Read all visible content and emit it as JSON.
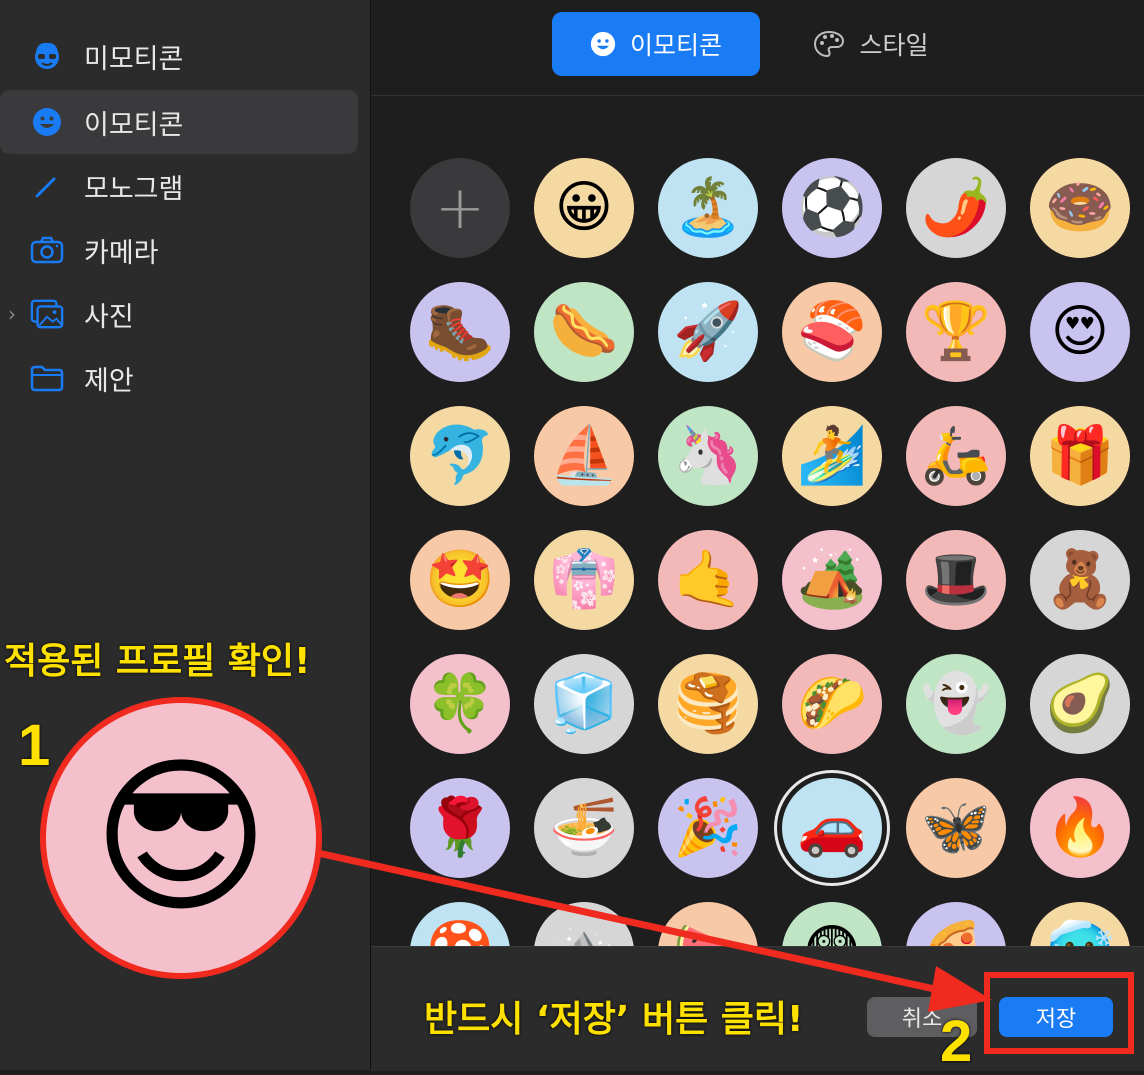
{
  "sidebar": {
    "items": [
      {
        "label": "미모티콘",
        "icon": "memoji-icon"
      },
      {
        "label": "이모티콘",
        "icon": "smiley-icon",
        "selected": true
      },
      {
        "label": "모노그램",
        "icon": "pencil-icon"
      },
      {
        "label": "카메라",
        "icon": "camera-icon"
      },
      {
        "label": "사진",
        "icon": "photos-icon",
        "expandable": true
      },
      {
        "label": "제안",
        "icon": "folder-icon"
      }
    ]
  },
  "tabs": [
    {
      "label": "이모티콘",
      "icon": "smiley-icon",
      "active": true
    },
    {
      "label": "스타일",
      "icon": "palette-icon",
      "active": false
    }
  ],
  "emoji_grid": {
    "add_label": "+",
    "rows": [
      [
        {
          "e": "😀",
          "bg": "#f5d9a3"
        },
        {
          "e": "🏝️",
          "bg": "#bfe3f3"
        },
        {
          "e": "⚽",
          "bg": "#c9c3ef"
        },
        {
          "e": "🌶️",
          "bg": "#d6d6d6"
        },
        {
          "e": "🍩",
          "bg": "#f5d9a3"
        }
      ],
      [
        {
          "e": "🥾",
          "bg": "#c9c3ef"
        },
        {
          "e": "🌭",
          "bg": "#bfe5c5"
        },
        {
          "e": "🚀",
          "bg": "#bfe3f3"
        },
        {
          "e": "🍣",
          "bg": "#f7c9a6"
        },
        {
          "e": "🏆",
          "bg": "#f3b8b8"
        },
        {
          "e": "😍",
          "bg": "#c9c3ef"
        }
      ],
      [
        {
          "e": "🐬",
          "bg": "#f5d9a3"
        },
        {
          "e": "⛵",
          "bg": "#f7c9a6"
        },
        {
          "e": "🦄",
          "bg": "#bfe5c5"
        },
        {
          "e": "🏄",
          "bg": "#f5d9a3"
        },
        {
          "e": "🛵",
          "bg": "#f3b8b8"
        },
        {
          "e": "🎁",
          "bg": "#f5d9a3"
        }
      ],
      [
        {
          "e": "🤩",
          "bg": "#f7c9a6"
        },
        {
          "e": "👘",
          "bg": "#f5d9a3"
        },
        {
          "e": "🤙",
          "bg": "#f3b8b8"
        },
        {
          "e": "🏕️",
          "bg": "#f4c0cc"
        },
        {
          "e": "🎩",
          "bg": "#f3b8b8"
        },
        {
          "e": "🧸",
          "bg": "#d6d6d6"
        }
      ],
      [
        {
          "e": "🍀",
          "bg": "#f4c0cc"
        },
        {
          "e": "🧊",
          "bg": "#d6d6d6"
        },
        {
          "e": "🥞",
          "bg": "#f5d9a3"
        },
        {
          "e": "🌮",
          "bg": "#f3b8b8"
        },
        {
          "e": "👻",
          "bg": "#bfe5c5"
        },
        {
          "e": "🥑",
          "bg": "#d6d6d6"
        }
      ],
      [
        {
          "e": "🌹",
          "bg": "#c9c3ef"
        },
        {
          "e": "🍜",
          "bg": "#d6d6d6"
        },
        {
          "e": "🎉",
          "bg": "#c9c3ef"
        },
        {
          "e": "🚗",
          "bg": "#bfe3f3",
          "selected": true
        },
        {
          "e": "🦋",
          "bg": "#f7c9a6"
        },
        {
          "e": "🔥",
          "bg": "#f4c0cc"
        }
      ],
      [
        {
          "e": "🍄",
          "bg": "#bfe3f3"
        },
        {
          "e": "⛰️",
          "bg": "#d6d6d6"
        },
        {
          "e": "🍉",
          "bg": "#f7c9a6"
        },
        {
          "e": "😨",
          "bg": "#bfe5c5"
        },
        {
          "e": "🍕",
          "bg": "#c9c3ef"
        },
        {
          "e": "🥶",
          "bg": "#f5d9a3"
        }
      ]
    ]
  },
  "footer": {
    "cancel_label": "취소",
    "save_label": "저장"
  },
  "annotations": {
    "title": "적용된 프로필 확인!",
    "num1": "1",
    "num2": "2",
    "footer_note": "반드시 ‘저장’ 버튼 클릭!",
    "profile_emoji": "😎"
  },
  "colors": {
    "accent": "#1a7cf5",
    "annotation_yellow": "#ffe100",
    "annotation_red": "#f02a1e"
  }
}
